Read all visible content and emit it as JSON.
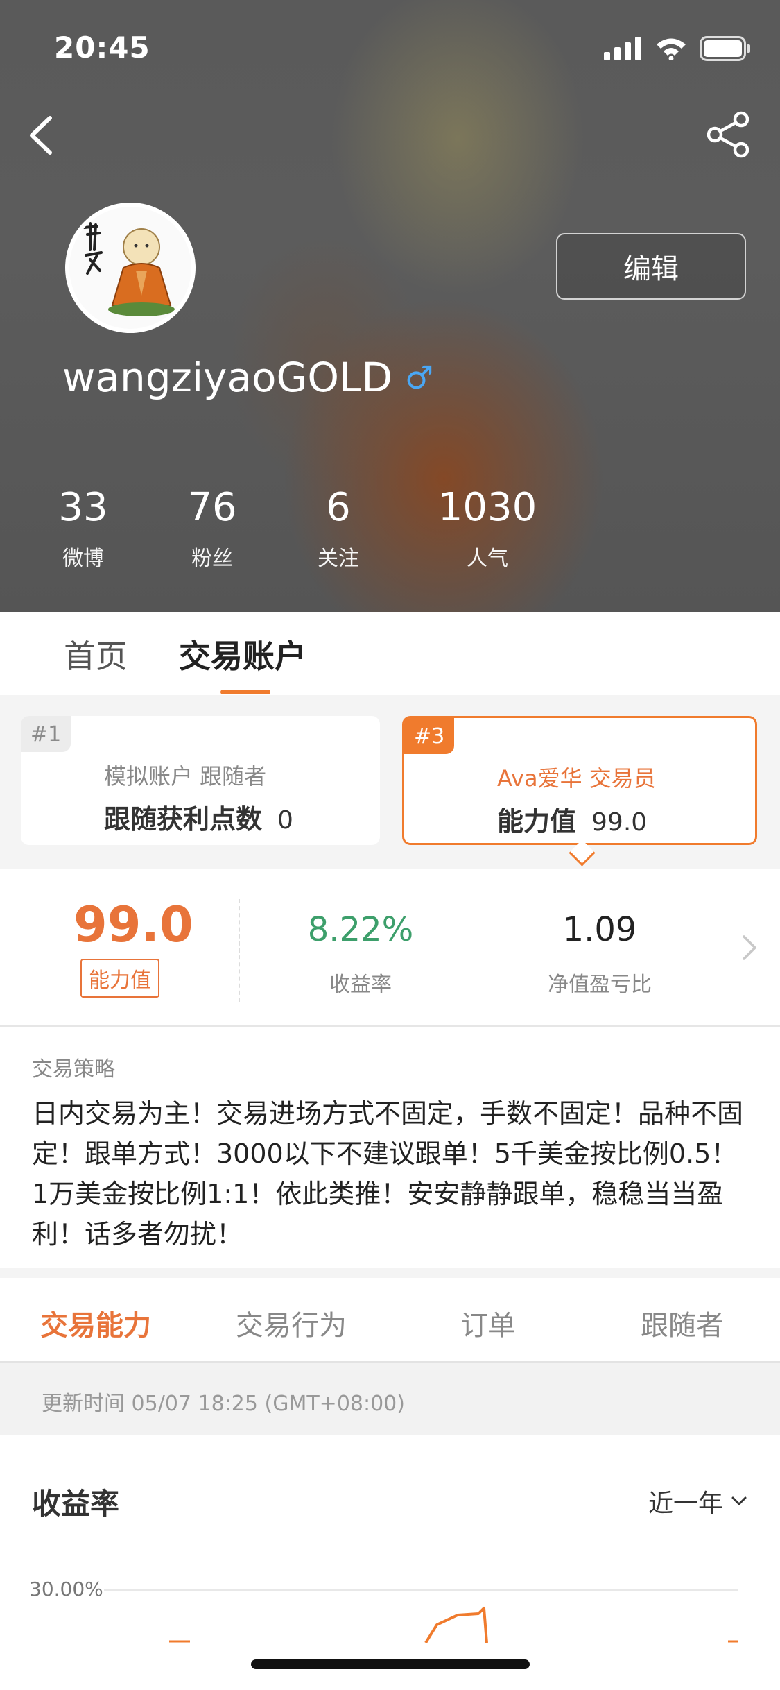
{
  "status_bar": {
    "time": "20:45"
  },
  "profile": {
    "username": "wangziyaoGOLD",
    "gender_symbol": "♂",
    "edit_label": "编辑",
    "stats": [
      {
        "value": "33",
        "label": "微博"
      },
      {
        "value": "76",
        "label": "粉丝"
      },
      {
        "value": "6",
        "label": "关注"
      },
      {
        "value": "1030",
        "label": "人气"
      }
    ]
  },
  "top_tabs": [
    {
      "label": "首页"
    },
    {
      "label": "交易账户"
    }
  ],
  "accounts": [
    {
      "rank": "#1",
      "line1": "模拟账户   跟随者",
      "metric_label": "跟随获利点数",
      "metric_value": "0"
    },
    {
      "rank": "#3",
      "line1": "Ava爱华   交易员",
      "metric_label": "能力值",
      "metric_value": "99.0"
    }
  ],
  "metrics": {
    "ability_value": "99.0",
    "ability_label": "能力值",
    "return_rate": "8.22%",
    "return_label": "收益率",
    "pl_ratio": "1.09",
    "pl_label": "净值盈亏比"
  },
  "strategy": {
    "title": "交易策略",
    "text": "日内交易为主！交易进场方式不固定，手数不固定！品种不固定！跟单方式！3000以下不建议跟单！5千美金按比例0.5！1万美金按比例1:1！依此类推！安安静静跟单，稳稳当当盈利！话多者勿扰！"
  },
  "section_tabs": [
    {
      "label": "交易能力"
    },
    {
      "label": "交易行为"
    },
    {
      "label": "订单"
    },
    {
      "label": "跟随者"
    }
  ],
  "update_time": "更新时间 05/07 18:25 (GMT+08:00)",
  "chart": {
    "title": "收益率",
    "range_label": "近一年",
    "y_tick": "30.00%"
  },
  "colors": {
    "accent": "#e8743a",
    "positive": "#3d9f6b",
    "gender": "#4aa7f4"
  }
}
